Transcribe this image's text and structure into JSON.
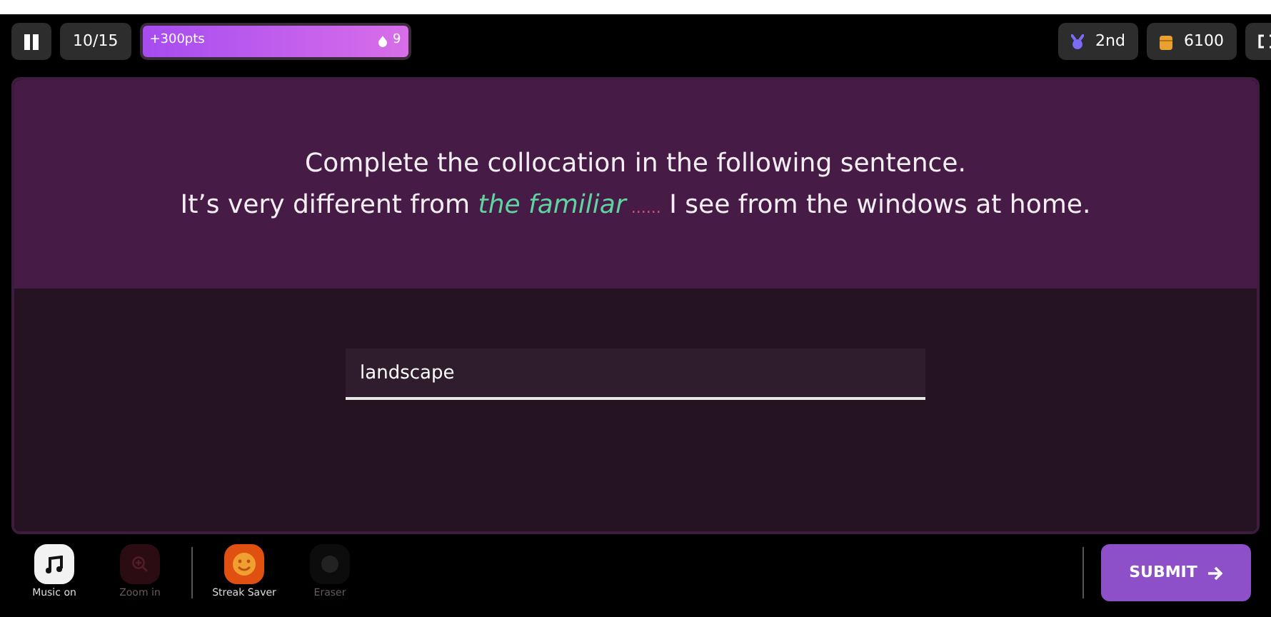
{
  "top_bar": {
    "progress": "10/15",
    "points": "+300pts",
    "streak": "9",
    "rank": "2nd",
    "coins": "6100"
  },
  "question": {
    "prompt": "Complete the collocation in the following sentence.",
    "sentence": [
      {
        "kind": "plain",
        "text": "It’s very different from "
      },
      {
        "kind": "highlight",
        "text": "the familiar"
      },
      {
        "kind": "blank",
        "text": " ......"
      },
      {
        "kind": "plain",
        "text": " I see from the windows at home."
      }
    ]
  },
  "answer": {
    "value": "landscape"
  },
  "power_ups": [
    {
      "kind": "music",
      "label": "Music on",
      "disabled": false
    },
    {
      "kind": "zoom",
      "label": "Zoom in",
      "disabled": true
    },
    {
      "kind": "streak",
      "label": "Streak Saver",
      "disabled": false
    },
    {
      "kind": "eraser",
      "label": "Eraser",
      "disabled": true
    }
  ],
  "submit": {
    "label": "SUBMIT"
  }
}
